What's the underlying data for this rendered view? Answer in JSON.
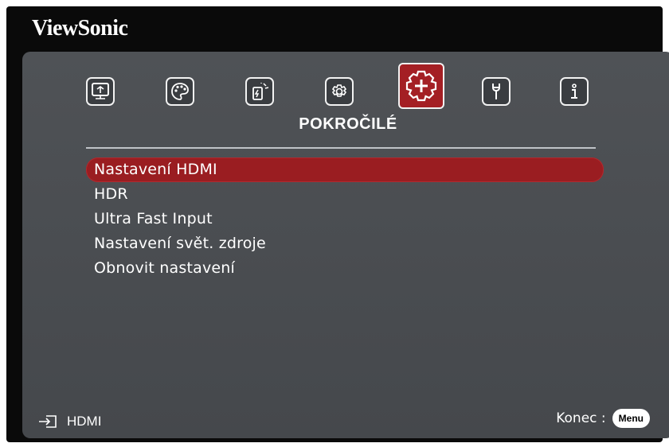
{
  "brand": "ViewSonic",
  "tabs": [
    {
      "icon": "display-icon"
    },
    {
      "icon": "palette-icon"
    },
    {
      "icon": "power-icon"
    },
    {
      "icon": "basic-gear-icon"
    },
    {
      "icon": "advanced-gear-icon"
    },
    {
      "icon": "wrench-icon"
    },
    {
      "icon": "info-icon"
    }
  ],
  "active_tab_label": "POKROČILÉ",
  "menu_items": [
    {
      "label": "Nastavení HDMI",
      "selected": true
    },
    {
      "label": "HDR"
    },
    {
      "label": "Ultra Fast Input"
    },
    {
      "label": "Nastavení svět. zdroje"
    },
    {
      "label": "Obnovit nastavení"
    }
  ],
  "footer": {
    "source_label": "HDMI",
    "exit_label": "Konec :",
    "menu_button": "Menu"
  },
  "colors": {
    "accent": "#9a1d21",
    "panel": "#4b4e52"
  }
}
